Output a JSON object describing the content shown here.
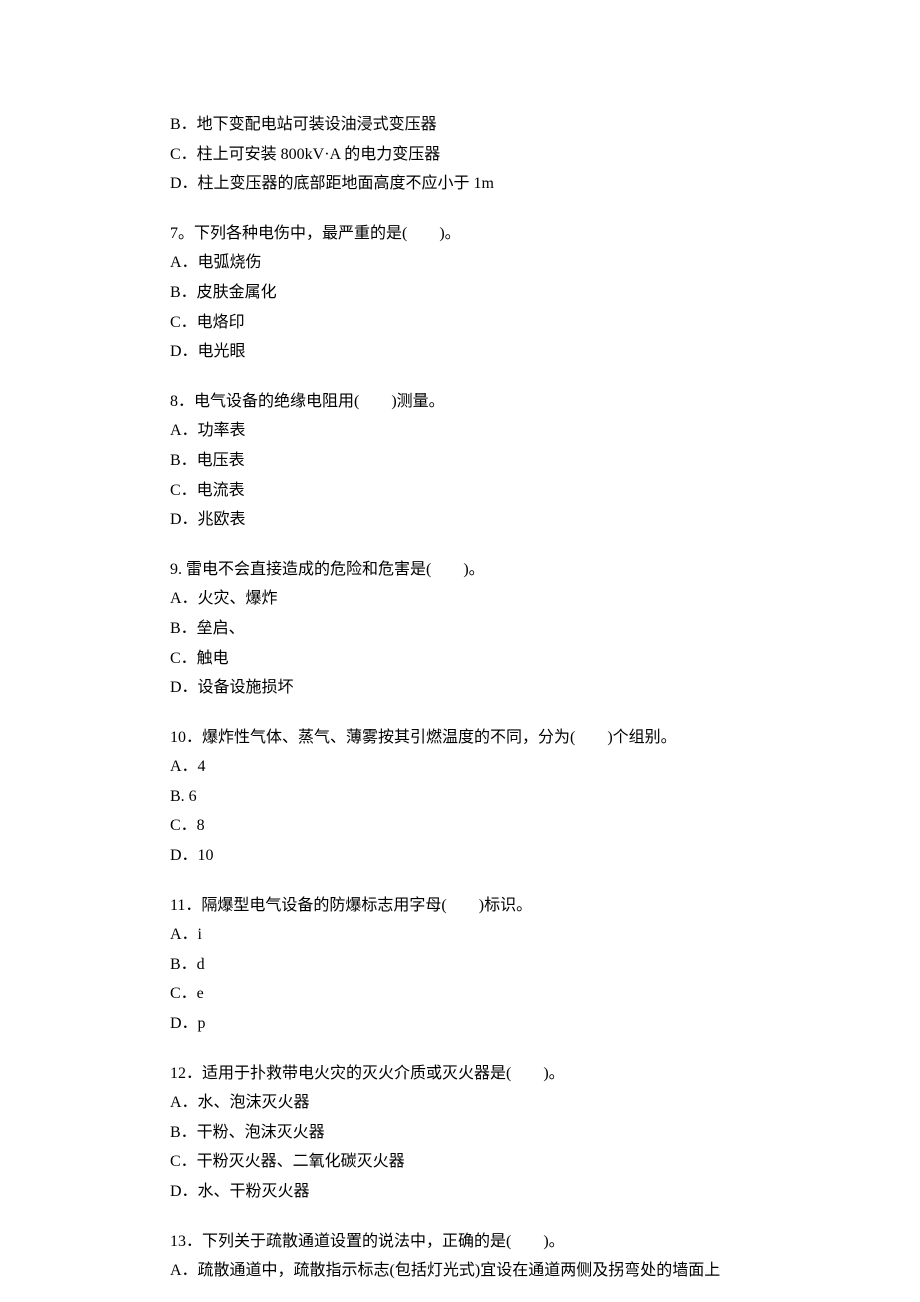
{
  "standalone_options": [
    "B．地下变配电站可装设油浸式变压器",
    "C．柱上可安装 800kV·A 的电力变压器",
    "D．柱上变压器的底部距地面高度不应小于 1m"
  ],
  "questions": [
    {
      "stem": "7。下列各种电伤中，最严重的是(　　)。",
      "options": [
        "A．电弧烧伤",
        "B．皮肤金属化",
        "C．电烙印",
        "D．电光眼"
      ]
    },
    {
      "stem": "8．电气设备的绝缘电阻用(　　)测量。",
      "options": [
        "A．功率表",
        "B．电压表",
        "C．电流表",
        "D．兆欧表"
      ]
    },
    {
      "stem": "9. 雷电不会直接造成的危险和危害是(　　)。",
      "options": [
        "A．火灾、爆炸",
        "B．垒启、",
        "C．触电",
        "D．设备设施损坏"
      ]
    },
    {
      "stem": "10．爆炸性气体、蒸气、薄雾按其引燃温度的不同，分为(　　)个组别。",
      "options": [
        "A．4",
        "B. 6",
        "C．8",
        "D．10"
      ]
    },
    {
      "stem": "11．隔爆型电气设备的防爆标志用字母(　　)标识。",
      "options": [
        "A．i",
        "B．d",
        "C．e",
        "D．p"
      ]
    },
    {
      "stem": "12．适用于扑救带电火灾的灭火介质或灭火器是(　　)。",
      "options": [
        "A．水、泡沫灭火器",
        "B．干粉、泡沫灭火器",
        "C．干粉灭火器、二氧化碳灭火器",
        "D．水、干粉灭火器"
      ]
    },
    {
      "stem": "13．下列关于疏散通道设置的说法中，正确的是(　　)。",
      "options": [
        "A．疏散通道中，疏散指示标志(包括灯光式)宜设在通道两侧及拐弯处的墙面上"
      ]
    }
  ]
}
